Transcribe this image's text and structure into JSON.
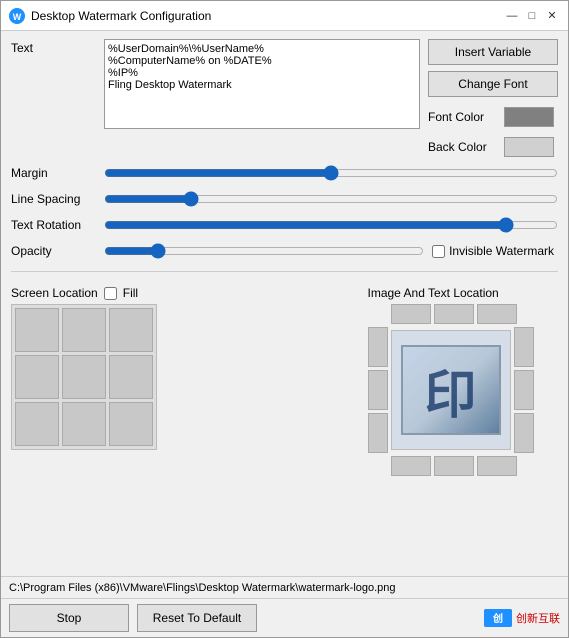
{
  "window": {
    "title": "Desktop Watermark Configuration",
    "icon": "watermark-icon"
  },
  "title_controls": {
    "minimize": "—",
    "maximize": "□",
    "close": "✕"
  },
  "text_section": {
    "label": "Text",
    "value": "%UserDomain%\\%UserName%\n%ComputerName% on %DATE%\n%IP%\nFling Desktop Watermark"
  },
  "buttons": {
    "insert_variable": "Insert Variable",
    "change_font": "Change Font"
  },
  "colors": {
    "font_color_label": "Font Color",
    "back_color_label": "Back Color",
    "font_color_value": "#808080",
    "back_color_value": "#d0d0d0"
  },
  "sliders": {
    "margin_label": "Margin",
    "margin_value": 50,
    "line_spacing_label": "Line Spacing",
    "line_spacing_value": 18,
    "text_rotation_label": "Text Rotation",
    "text_rotation_value": 90,
    "opacity_label": "Opacity",
    "opacity_value": 15
  },
  "invisible_watermark": {
    "label": "Invisible Watermark",
    "checked": false
  },
  "screen_location": {
    "label": "Screen Location",
    "fill_label": "Fill",
    "fill_checked": false
  },
  "image_location": {
    "label": "Image And Text Location"
  },
  "status_bar": {
    "path": "C:\\Program Files (x86)\\VMware\\Flings\\Desktop Watermark\\watermark-logo.png"
  },
  "bottom_buttons": {
    "stop": "Stop",
    "reset": "Reset To Default"
  },
  "brand": {
    "name": "创新互联",
    "logo": "创"
  }
}
